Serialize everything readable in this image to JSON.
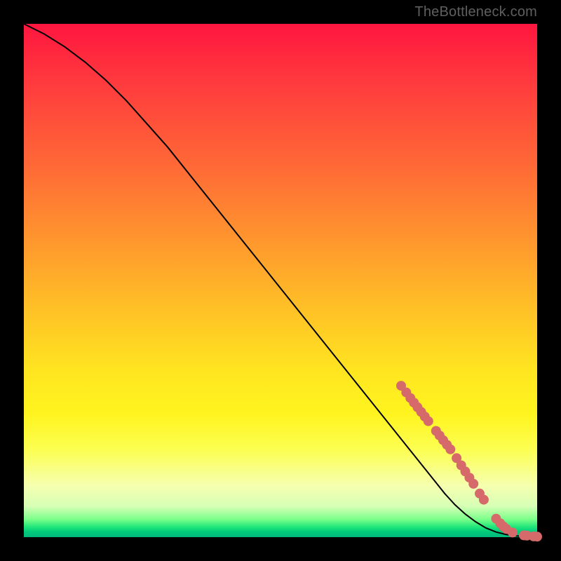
{
  "attribution": "TheBottleneck.com",
  "colors": {
    "frame": "#000000",
    "dot": "#d66a6a",
    "line": "#000000"
  },
  "chart_data": {
    "type": "line",
    "title": "",
    "xlabel": "",
    "ylabel": "",
    "xlim": [
      0,
      100
    ],
    "ylim": [
      0,
      100
    ],
    "grid": false,
    "legend": false,
    "series": [
      {
        "name": "bottleneck-curve",
        "x": [
          0,
          4,
          8,
          12,
          16,
          20,
          24,
          28,
          32,
          36,
          40,
          44,
          48,
          52,
          56,
          60,
          64,
          68,
          72,
          76,
          80,
          82,
          84,
          86,
          88,
          90,
          92,
          94,
          96,
          98,
          100
        ],
        "y": [
          100,
          98,
          95.5,
          92.5,
          89,
          85,
          80.5,
          76,
          71,
          66,
          61,
          56,
          51,
          46,
          41,
          36,
          31,
          26,
          21,
          16,
          11,
          8.5,
          6.3,
          4.5,
          3.0,
          1.8,
          1.0,
          0.5,
          0.25,
          0.1,
          0
        ]
      }
    ],
    "scatter_overlay": {
      "name": "highlighted-points",
      "points": [
        {
          "x": 73.5,
          "y": 29.5
        },
        {
          "x": 74.5,
          "y": 28.2
        },
        {
          "x": 75.3,
          "y": 27.1
        },
        {
          "x": 76.0,
          "y": 26.2
        },
        {
          "x": 76.7,
          "y": 25.3
        },
        {
          "x": 77.4,
          "y": 24.4
        },
        {
          "x": 78.1,
          "y": 23.5
        },
        {
          "x": 78.8,
          "y": 22.6
        },
        {
          "x": 80.3,
          "y": 20.7
        },
        {
          "x": 81.0,
          "y": 19.8
        },
        {
          "x": 81.7,
          "y": 18.9
        },
        {
          "x": 82.4,
          "y": 18.0
        },
        {
          "x": 83.1,
          "y": 17.1
        },
        {
          "x": 84.3,
          "y": 15.4
        },
        {
          "x": 85.2,
          "y": 14.0
        },
        {
          "x": 86.0,
          "y": 12.8
        },
        {
          "x": 86.8,
          "y": 11.6
        },
        {
          "x": 87.6,
          "y": 10.4
        },
        {
          "x": 88.8,
          "y": 8.5
        },
        {
          "x": 89.6,
          "y": 7.3
        },
        {
          "x": 92.0,
          "y": 3.6
        },
        {
          "x": 92.8,
          "y": 2.7
        },
        {
          "x": 93.4,
          "y": 2.1
        },
        {
          "x": 94.0,
          "y": 1.6
        },
        {
          "x": 95.2,
          "y": 0.9
        },
        {
          "x": 97.4,
          "y": 0.35
        },
        {
          "x": 98.0,
          "y": 0.3
        },
        {
          "x": 99.3,
          "y": 0.15
        },
        {
          "x": 100.0,
          "y": 0.1
        }
      ]
    }
  }
}
